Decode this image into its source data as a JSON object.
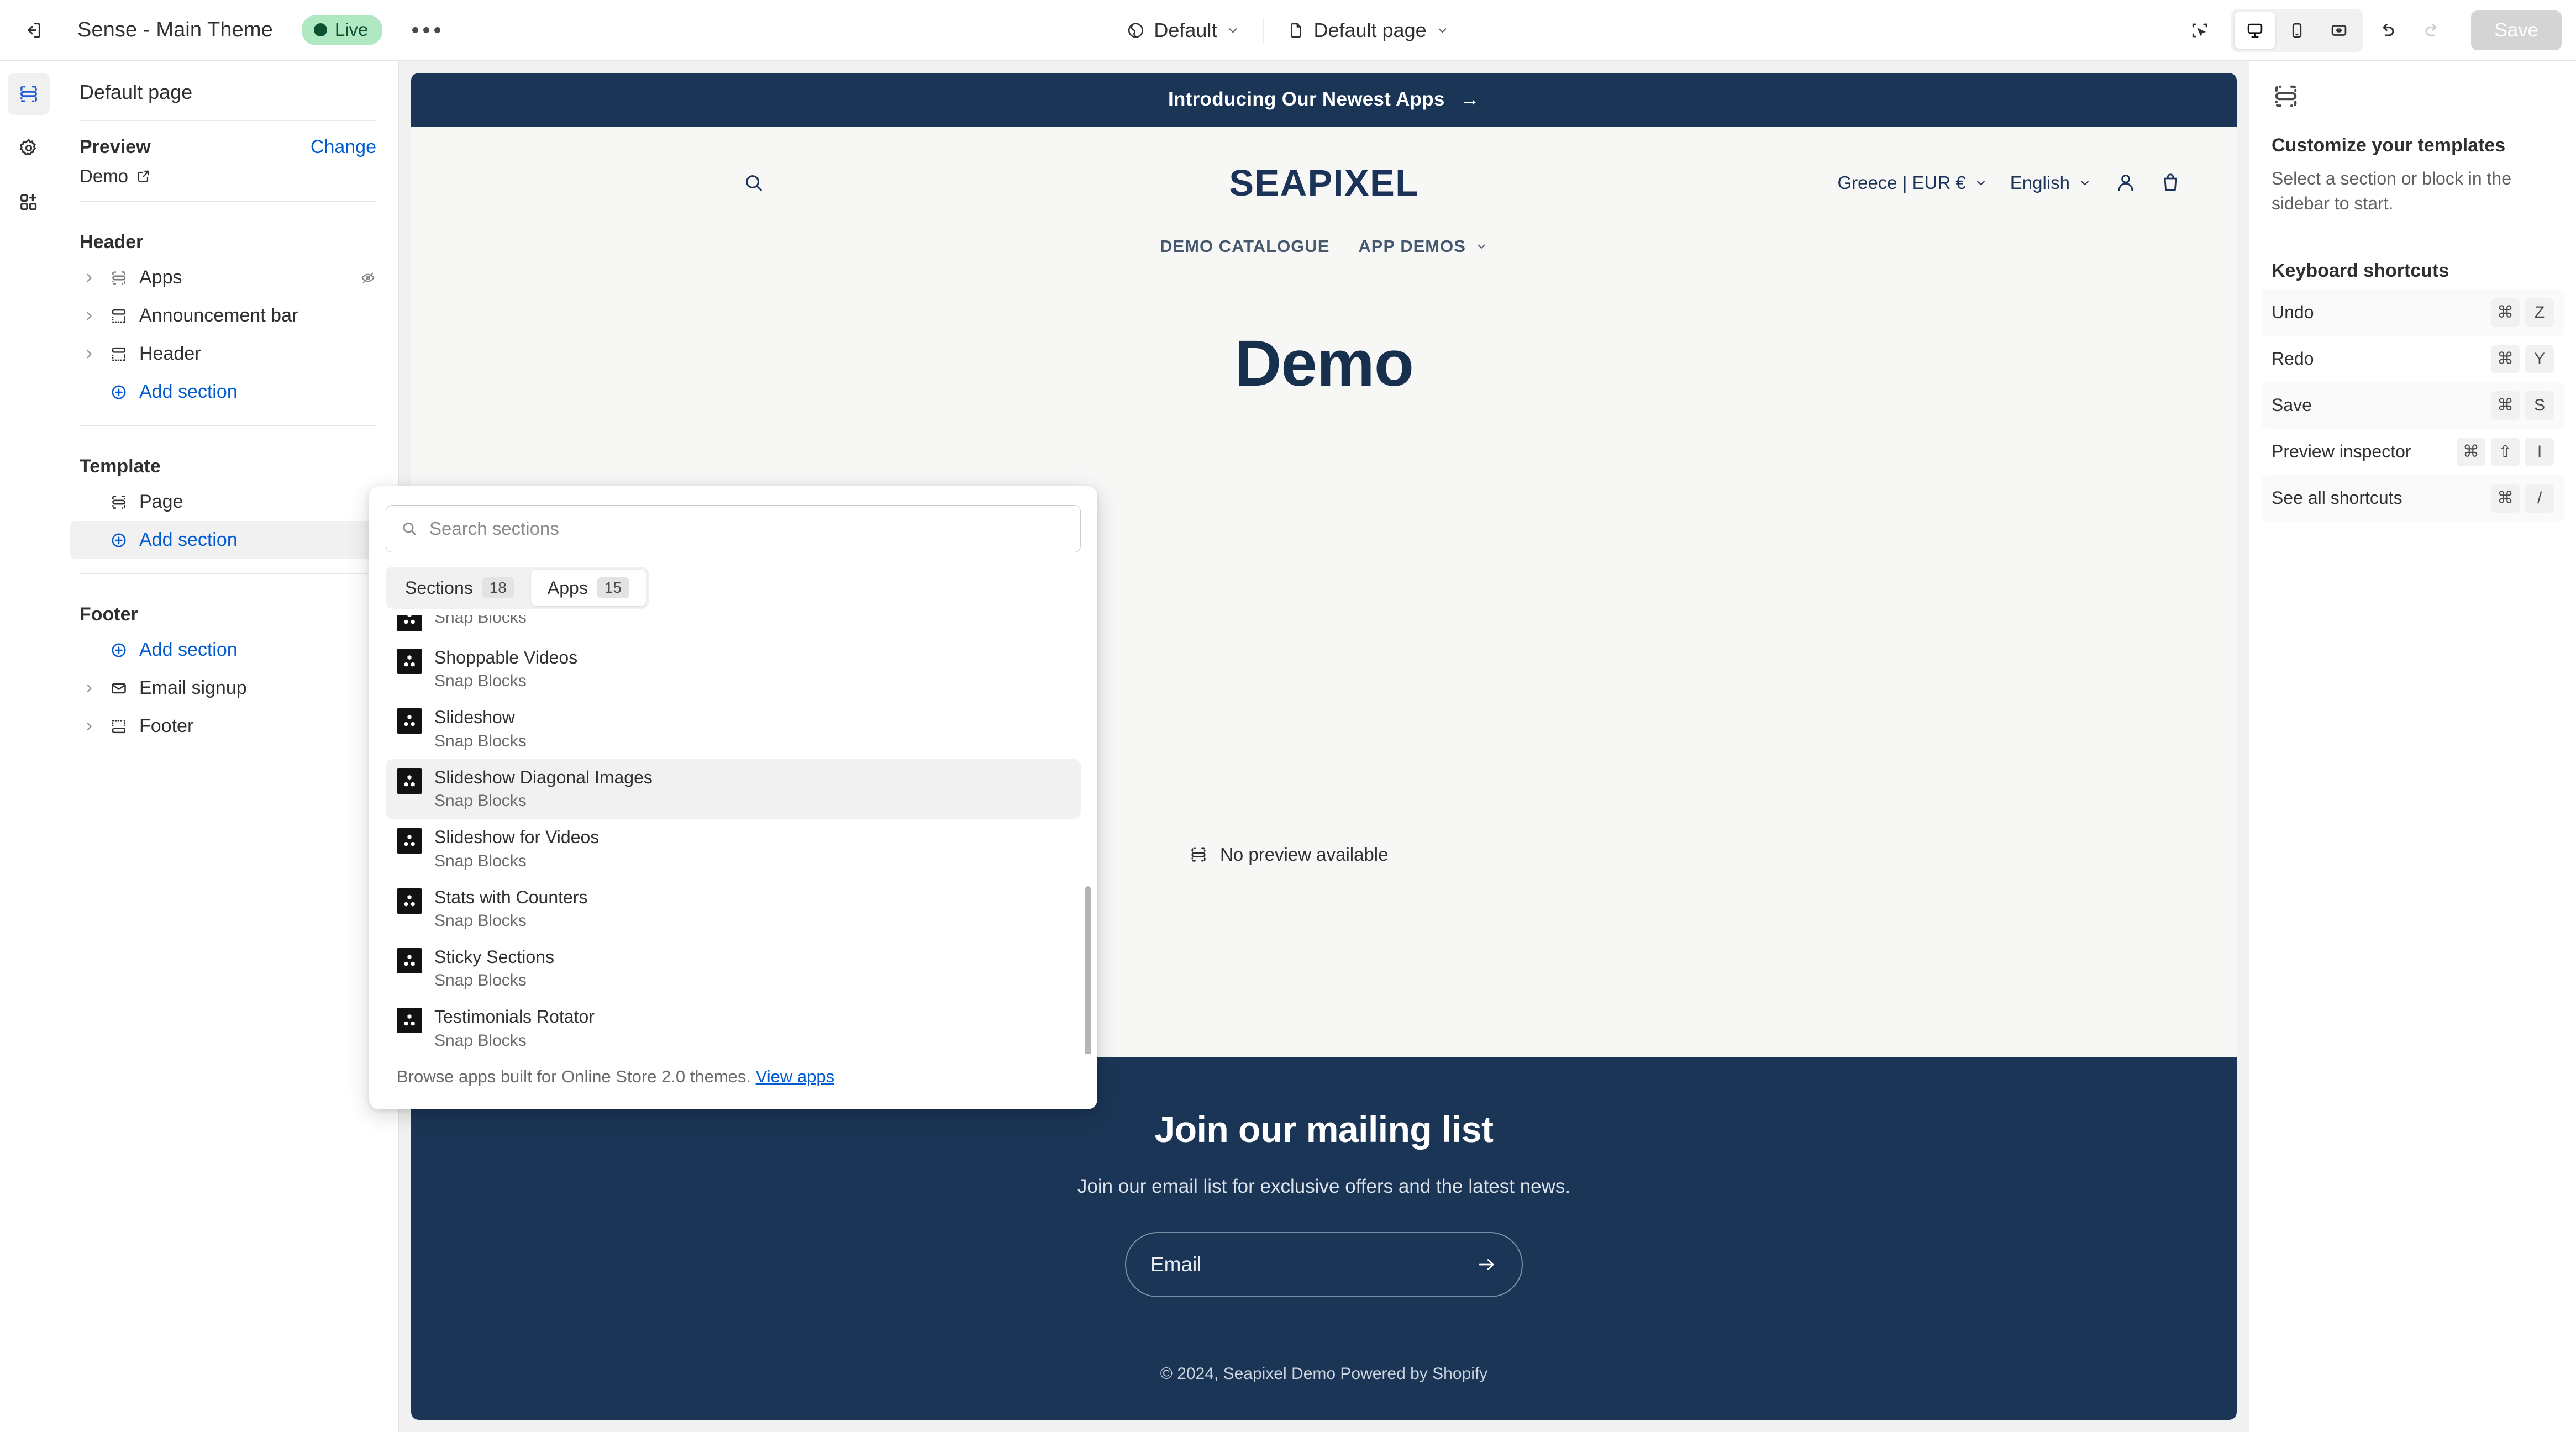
{
  "topbar": {
    "exit_icon": "exit-icon",
    "theme_name": "Sense - Main Theme",
    "live_label": "Live",
    "more_icon": "more-menu-icon",
    "market_icon": "globe-icon",
    "market_label": "Default",
    "page_icon": "page-icon",
    "page_label": "Default page",
    "inspector_icon": "preview-inspector-icon",
    "desktop_icon": "desktop-icon",
    "mobile_icon": "mobile-icon",
    "fullwidth_icon": "full-width-icon",
    "undo_icon": "undo-icon",
    "redo_icon": "redo-icon",
    "save_label": "Save"
  },
  "rail": {
    "sections_icon": "sections-icon",
    "settings_icon": "gear-icon",
    "apps_icon": "add-app-icon"
  },
  "sidebar": {
    "title": "Default page",
    "preview_label": "Preview",
    "change_label": "Change",
    "preview_value": "Demo",
    "external_icon": "external-link-icon",
    "groups": [
      {
        "name": "Header",
        "items": [
          {
            "label": "Apps",
            "icon": "section-icon",
            "expandable": true,
            "hidden_icon": "hidden-eye-icon"
          },
          {
            "label": "Announcement bar",
            "icon": "announcement-icon",
            "expandable": true
          },
          {
            "label": "Header",
            "icon": "header-icon",
            "expandable": true
          }
        ],
        "add_label": "Add section"
      },
      {
        "name": "Template",
        "items": [
          {
            "label": "Page",
            "icon": "page-section-icon",
            "expandable": false
          }
        ],
        "add_label": "Add section",
        "add_active": true
      },
      {
        "name": "Footer",
        "add_label": "Add section",
        "items": [
          {
            "label": "Email signup",
            "icon": "email-icon",
            "expandable": true
          },
          {
            "label": "Footer",
            "icon": "footer-icon",
            "expandable": true
          }
        ]
      }
    ]
  },
  "popover": {
    "search_placeholder": "Search sections",
    "search_icon": "search-icon",
    "tabs": [
      {
        "label": "Sections",
        "count": "18",
        "selected": true
      },
      {
        "label": "Apps",
        "count": "15",
        "selected": false
      }
    ],
    "items": [
      {
        "name": "",
        "subtitle": "Snap Blocks",
        "highlighted": false
      },
      {
        "name": "Shoppable Videos",
        "subtitle": "Snap Blocks",
        "highlighted": false
      },
      {
        "name": "Slideshow",
        "subtitle": "Snap Blocks",
        "highlighted": false
      },
      {
        "name": "Slideshow Diagonal Images",
        "subtitle": "Snap Blocks",
        "highlighted": true
      },
      {
        "name": "Slideshow for Videos",
        "subtitle": "Snap Blocks",
        "highlighted": false
      },
      {
        "name": "Stats with Counters",
        "subtitle": "Snap Blocks",
        "highlighted": false
      },
      {
        "name": "Sticky Sections",
        "subtitle": "Snap Blocks",
        "highlighted": false
      },
      {
        "name": "Testimonials Rotator",
        "subtitle": "Snap Blocks",
        "highlighted": false
      }
    ],
    "footer_text": "Browse apps built for Online Store 2.0 themes. ",
    "footer_link": "View apps"
  },
  "preview": {
    "no_preview_label": "No preview available",
    "no_preview_icon": "section-placeholder-icon",
    "announcement": "Introducing Our Newest Apps",
    "announcement_arrow": "→",
    "search_icon": "storefront-search-icon",
    "logo": "SEAPIXEL",
    "locale_country": "Greece | EUR €",
    "locale_language": "English",
    "account_icon": "account-icon",
    "cart_icon": "cart-icon",
    "nav": [
      {
        "label": "DEMO CATALOGUE",
        "has_caret": false
      },
      {
        "label": "APP DEMOS",
        "has_caret": true
      }
    ],
    "hero_title": "Demo",
    "newsletter_title": "Join our mailing list",
    "newsletter_sub": "Join our email list for exclusive offers and the latest news.",
    "email_placeholder": "Email",
    "email_submit_icon": "arrow-right-icon",
    "copyright": "© 2024, Seapixel Demo Powered by Shopify"
  },
  "right_panel": {
    "header_icon": "section-placeholder-icon",
    "title": "Customize your templates",
    "description": "Select a section or block in the sidebar to start.",
    "shortcuts_title": "Keyboard shortcuts",
    "shortcuts": [
      {
        "label": "Undo",
        "keys": [
          "⌘",
          "Z"
        ]
      },
      {
        "label": "Redo",
        "keys": [
          "⌘",
          "Y"
        ]
      },
      {
        "label": "Save",
        "keys": [
          "⌘",
          "S"
        ]
      },
      {
        "label": "Preview inspector",
        "keys": [
          "⌘",
          "⇧",
          "I"
        ]
      },
      {
        "label": "See all shortcuts",
        "keys": [
          "⌘",
          "/"
        ]
      }
    ]
  },
  "colors": {
    "brand_navy": "#1b3556",
    "accent_blue": "#005bd3",
    "live_green_bg": "#afe8c1",
    "live_green_fg": "#0c5132"
  }
}
